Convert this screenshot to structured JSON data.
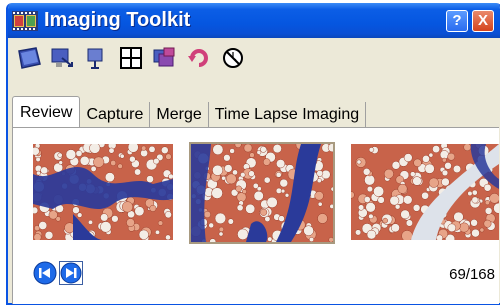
{
  "window": {
    "title": "Imaging Toolkit",
    "help_label": "?",
    "close_label": "X"
  },
  "toolbar": {
    "tools": [
      {
        "name": "slide-icon"
      },
      {
        "name": "export-icon"
      },
      {
        "name": "pin-icon"
      },
      {
        "name": "grid-icon"
      },
      {
        "name": "stack-icon"
      },
      {
        "name": "rotate-icon"
      },
      {
        "name": "no-sign-icon"
      }
    ]
  },
  "tabs": [
    {
      "label": "Review",
      "active": true
    },
    {
      "label": "Capture"
    },
    {
      "label": "Merge"
    },
    {
      "label": "Time Lapse Imaging"
    }
  ],
  "review": {
    "thumbnails": [
      {
        "name": "thumbnail-1"
      },
      {
        "name": "thumbnail-2",
        "selected": true
      },
      {
        "name": "thumbnail-3"
      }
    ],
    "counter": "69/168"
  },
  "colors": {
    "accent": "#0556e0",
    "stain_red": "#c8634a",
    "stain_blue": "#2a3a9a"
  }
}
